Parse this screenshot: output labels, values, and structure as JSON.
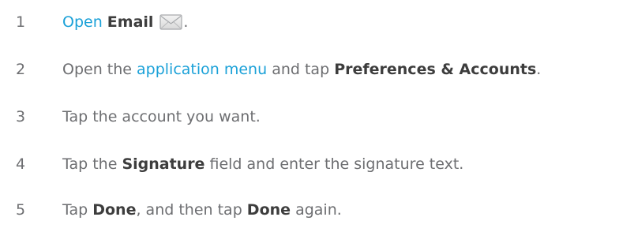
{
  "steps": [
    {
      "number": "1",
      "parts": [
        {
          "text": "Open",
          "style": "link"
        },
        {
          "text": " ",
          "style": "plain"
        },
        {
          "text": "Email",
          "style": "bold"
        },
        {
          "icon": "email-envelope-icon"
        },
        {
          "text": ".",
          "style": "plain"
        }
      ]
    },
    {
      "number": "2",
      "parts": [
        {
          "text": "Open the ",
          "style": "plain"
        },
        {
          "text": "application menu",
          "style": "link"
        },
        {
          "text": " and tap ",
          "style": "plain"
        },
        {
          "text": "Preferences & Accounts",
          "style": "bold"
        },
        {
          "text": ".",
          "style": "plain"
        }
      ]
    },
    {
      "number": "3",
      "parts": [
        {
          "text": "Tap the account you want.",
          "style": "plain"
        }
      ]
    },
    {
      "number": "4",
      "parts": [
        {
          "text": "Tap the ",
          "style": "plain"
        },
        {
          "text": "Signature",
          "style": "bold"
        },
        {
          "text": " field and enter the signature text.",
          "style": "plain"
        }
      ]
    },
    {
      "number": "5",
      "parts": [
        {
          "text": "Tap ",
          "style": "plain"
        },
        {
          "text": "Done",
          "style": "bold"
        },
        {
          "text": ", and then tap ",
          "style": "plain"
        },
        {
          "text": "Done",
          "style": "bold"
        },
        {
          "text": " again.",
          "style": "plain"
        }
      ]
    }
  ],
  "colors": {
    "body_text": "#6d6e71",
    "link": "#1ba1d8",
    "bold_text": "#3d3d3d"
  }
}
